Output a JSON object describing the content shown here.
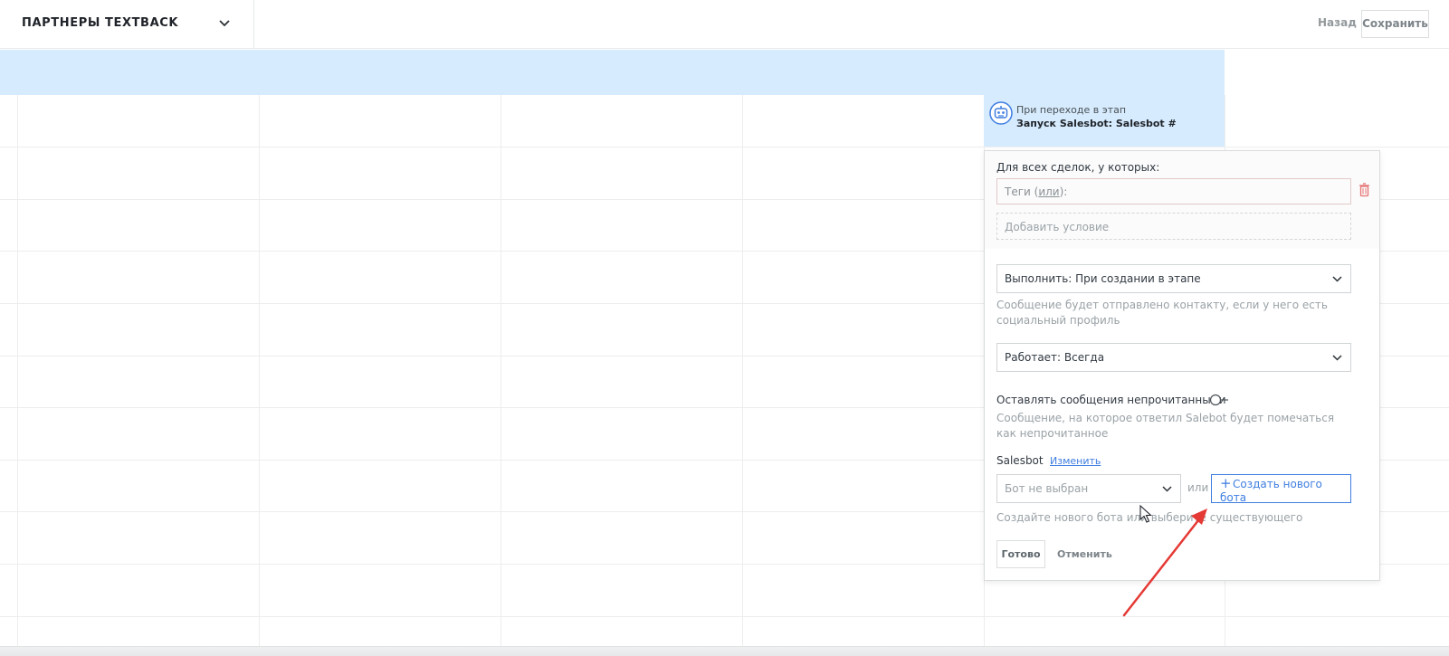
{
  "header": {
    "pipeline_title": "ПАРТНЕРЫ TEXTBACK",
    "back_label": "Назад",
    "save_label": "Сохранить"
  },
  "trigger": {
    "caption": "При переходе в этап",
    "name": "Запуск Salesbot: Salesbot #"
  },
  "panel": {
    "for_all_label": "Для всех сделок, у которых:",
    "tags_label": "Теги (",
    "tags_or": "или",
    "tags_suffix": "):",
    "add_condition": "Добавить условие",
    "execute_select": "Выполнить: При создании в этапе",
    "execute_hint": "Сообщение будет отправлено контакту, если у него есть социальный профиль",
    "works_select": "Работает: Всегда",
    "keep_unread_label": "Оставлять сообщения непрочитанными",
    "keep_unread_hint": "Сообщение, на которое ответил Salebot будет помечаться как непрочитанное",
    "keep_unread_on": false,
    "salesbot_label": "Salesbot",
    "change_link": "Изменить",
    "bot_select": "Бот не выбран",
    "or_text": "или",
    "create_bot_label": "Создать нового бота",
    "create_hint": "Создайте нового бота или выберите существующего",
    "done_label": "Готово",
    "cancel_label": "Отменить"
  },
  "colors": {
    "band": "#d6ebfd",
    "accent": "#3f7ee0",
    "annotation_arrow": "#e53935",
    "trash": "#e57373"
  }
}
